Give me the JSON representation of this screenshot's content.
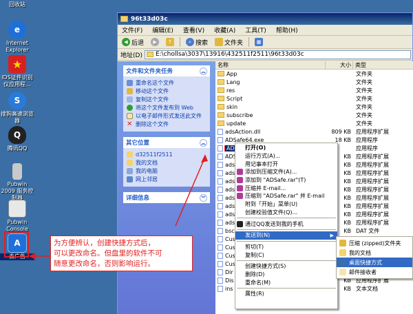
{
  "desktop": {
    "icons": [
      {
        "label": "回收站",
        "icon": "recycle-bin-icon"
      },
      {
        "label": "Internet Explorer",
        "icon": "ie-icon"
      },
      {
        "label": "IDS证件识别仪应用程...",
        "icon": "star-icon"
      },
      {
        "label": "搜狗高速浏览器",
        "icon": "sogou-browser-icon"
      },
      {
        "label": "腾讯QQ",
        "icon": "qq-icon"
      },
      {
        "label": "Pubwin 2009 服务控制器",
        "icon": "pubwin-icon"
      },
      {
        "label": "Pubwin Console",
        "icon": "console-icon"
      },
      {
        "label": "去广告",
        "icon": "shortcut-app-icon"
      }
    ]
  },
  "window": {
    "title": "96t33d03c",
    "menu": [
      "文件(F)",
      "编辑(E)",
      "查看(V)",
      "收藏(A)",
      "工具(T)",
      "帮助(H)"
    ],
    "toolbar": {
      "back": "后退",
      "search": "搜索",
      "folders": "文件夹"
    },
    "address": {
      "label": "地址(D)",
      "value": "E:\\chollsa\\3037\\13916\\432511f2511\\96t33d03c"
    }
  },
  "tasks_panel": {
    "title": "文件和文件夹任务",
    "items": [
      "重命名这个文件",
      "移动这个文件",
      "复制这个文件",
      "将这个文件发布到 Web",
      "以电子邮件形式发送此文件",
      "删除这个文件"
    ]
  },
  "places_panel": {
    "title": "其它位置",
    "items": [
      "d32511f2511",
      "我的文档",
      "我的电脑",
      "网上邻居"
    ]
  },
  "details_panel": {
    "title": "详细信息"
  },
  "filelist": {
    "columns": [
      "名称",
      "大小",
      "类型"
    ],
    "rows": [
      {
        "name": "App",
        "size": "",
        "type": "文件夹",
        "kind": "folder"
      },
      {
        "name": "Lang",
        "size": "",
        "type": "文件夹",
        "kind": "folder"
      },
      {
        "name": "res",
        "size": "",
        "type": "文件夹",
        "kind": "folder"
      },
      {
        "name": "Script",
        "size": "",
        "type": "文件夹",
        "kind": "folder"
      },
      {
        "name": "skin",
        "size": "",
        "type": "文件夹",
        "kind": "folder"
      },
      {
        "name": "subscribe",
        "size": "",
        "type": "文件夹",
        "kind": "folder"
      },
      {
        "name": "update",
        "size": "",
        "type": "文件夹",
        "kind": "folder"
      },
      {
        "name": "adsAction.dll",
        "size": "809 KB",
        "type": "应用程序扩展",
        "kind": "file"
      },
      {
        "name": "ADSafe64.exe",
        "size": "18 KB",
        "type": "应用程序",
        "kind": "file"
      },
      {
        "name": "ADS",
        "size": "",
        "type": "应用程序",
        "kind": "file",
        "selected": true
      },
      {
        "name": "ADS",
        "size": "KB",
        "type": "应用程序扩展",
        "kind": "file"
      },
      {
        "name": "ads",
        "size": "KB",
        "type": "应用程序扩展",
        "kind": "file"
      },
      {
        "name": "ads",
        "size": "KB",
        "type": "应用程序扩展",
        "kind": "file"
      },
      {
        "name": "ads",
        "size": "KB",
        "type": "应用程序扩展",
        "kind": "file"
      },
      {
        "name": "ads",
        "size": "KB",
        "type": "应用程序扩展",
        "kind": "file"
      },
      {
        "name": "ads",
        "size": "KB",
        "type": "应用程序扩展",
        "kind": "file"
      },
      {
        "name": "ads",
        "size": "KB",
        "type": "应用程序扩展",
        "kind": "file"
      },
      {
        "name": "ads",
        "size": "KB",
        "type": "应用程序扩展",
        "kind": "file"
      },
      {
        "name": "ads",
        "size": "KB",
        "type": "应用程序扩展",
        "kind": "file"
      },
      {
        "name": "bsc",
        "size": "KB",
        "type": "DAT 文件",
        "kind": "file"
      },
      {
        "name": "Cus",
        "size": "KB",
        "type": "应用程序扩展",
        "kind": "file"
      },
      {
        "name": "Cus",
        "size": "KB",
        "type": "应用程序扩展",
        "kind": "file"
      },
      {
        "name": "Cus",
        "size": "KB",
        "type": "应用程序扩展",
        "kind": "file"
      },
      {
        "name": "Cus",
        "size": "KB",
        "type": "应用程序扩展",
        "kind": "file"
      },
      {
        "name": "Dir",
        "size": "KB",
        "type": "应用程序扩展",
        "kind": "file"
      },
      {
        "name": "Dis",
        "size": "KB",
        "type": "应用程序扩展",
        "kind": "file"
      },
      {
        "name": "ins",
        "size": "KB",
        "type": "文本文档",
        "kind": "file"
      }
    ]
  },
  "context_menu": {
    "items": [
      {
        "label": "打开(O)",
        "bold": true,
        "icon": ""
      },
      {
        "label": "运行方式(A)...",
        "icon": ""
      },
      {
        "label": "用记事本打开",
        "icon": ""
      },
      {
        "label": "添加到压缩文件(A)...",
        "icon": "archive-icon"
      },
      {
        "label": "添加到 \"ADSafe.rar\"(T)",
        "icon": "archive-icon"
      },
      {
        "label": "压缩并 E-mail...",
        "icon": "archive-icon"
      },
      {
        "label": "压缩到 \"ADSafe.rar\" 并 E-mail",
        "icon": "archive-icon"
      },
      {
        "label": "附到「开始」菜单(U)",
        "icon": ""
      },
      {
        "label": "创建校验值文件(Q)...",
        "icon": ""
      },
      {
        "sep": true
      },
      {
        "label": "通过QQ发送到我的手机",
        "icon": "qq-icon"
      },
      {
        "sep": true
      },
      {
        "label": "发送到(N)",
        "icon": "",
        "highlight": true,
        "submenu": true
      },
      {
        "sep": true
      },
      {
        "label": "剪切(T)",
        "icon": ""
      },
      {
        "label": "复制(C)",
        "icon": ""
      },
      {
        "sep": true
      },
      {
        "label": "创建快捷方式(S)",
        "icon": ""
      },
      {
        "label": "删除(D)",
        "icon": ""
      },
      {
        "label": "重命名(M)",
        "icon": ""
      },
      {
        "sep": true
      },
      {
        "label": "属性(R)",
        "icon": ""
      }
    ]
  },
  "submenu": {
    "items": [
      {
        "label": "压缩 (zipped)文件夹",
        "icon": "zip-folder-icon"
      },
      {
        "label": "我的文档",
        "icon": "my-documents-icon"
      },
      {
        "label": "桌面快捷方式",
        "icon": "desktop-icon",
        "highlight": true
      },
      {
        "label": "邮件接收者",
        "icon": "mail-icon"
      }
    ]
  },
  "annotation": {
    "lines": [
      "为方便辨认，创建快捷方式后，",
      "可以更改命名。但盘里的软件不可",
      "随意更改命名，否则影响运行。"
    ]
  }
}
